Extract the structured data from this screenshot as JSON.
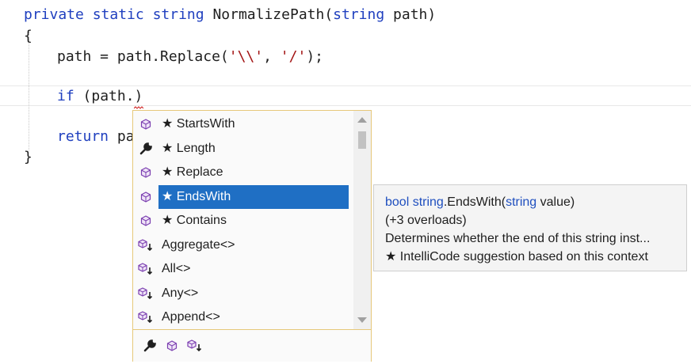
{
  "code": {
    "line1": {
      "kw1": "private",
      "kw2": "static",
      "kw3": "string",
      "name": "NormalizePath(",
      "kw4": "string",
      "rest": " path)"
    },
    "line2": "{",
    "line3": {
      "pre": "path = path.Replace(",
      "s1": "'\\\\'",
      "mid": ", ",
      "s2": "'/'",
      "post": ");"
    },
    "line4": {
      "kw": "if",
      "rest": " (path.",
      "close": ")"
    },
    "line5": {
      "kw": "return",
      "rest": " pa"
    },
    "line6": "}"
  },
  "completion": {
    "items": [
      {
        "label": "★ StartsWith",
        "icon": "method-icon"
      },
      {
        "label": "★ Length",
        "icon": "property-icon"
      },
      {
        "label": "★ Replace",
        "icon": "method-icon"
      },
      {
        "label": "★ EndsWith",
        "icon": "method-icon",
        "selected": true
      },
      {
        "label": "★ Contains",
        "icon": "method-icon"
      },
      {
        "label": "Aggregate<>",
        "icon": "extension-method-icon"
      },
      {
        "label": "All<>",
        "icon": "extension-method-icon"
      },
      {
        "label": "Any<>",
        "icon": "extension-method-icon"
      },
      {
        "label": "Append<>",
        "icon": "extension-method-icon"
      }
    ],
    "filters": [
      "property-icon",
      "method-icon",
      "extension-method-icon"
    ]
  },
  "tooltip": {
    "sig_type": "bool",
    "sig_class": "string",
    "sig_method": ".EndsWith(",
    "sig_ptype": "string",
    "sig_rest": " value)",
    "overloads": "(+3 overloads)",
    "description": "Determines whether the end of this string inst...",
    "intellicode": "★ IntelliCode suggestion based on this context"
  },
  "colors": {
    "keyword": "#1f3fbf",
    "string": "#a31515",
    "selection": "#1f6fc4",
    "popup_border": "#e6c87a"
  }
}
